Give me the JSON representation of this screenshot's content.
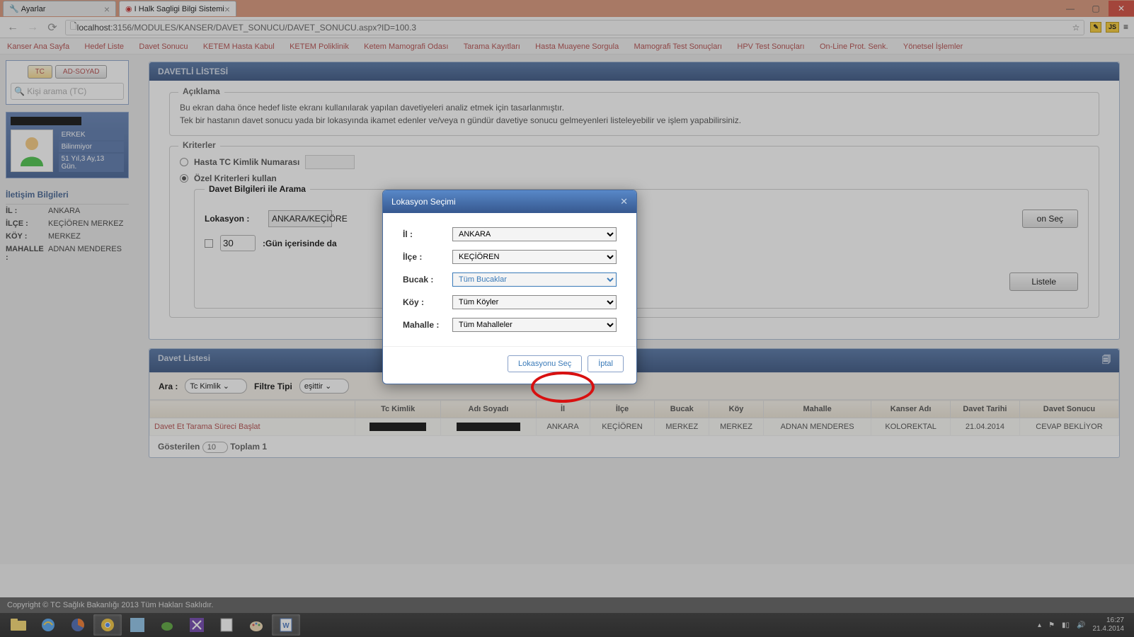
{
  "browser": {
    "tab1": "Ayarlar",
    "tab2": "I Halk Sagligi Bilgi Sistemi",
    "url_host": "localhost",
    "url_path": ":3156/MODULES/KANSER/DAVET_SONUCU/DAVET_SONUCU.aspx?ID=100.3"
  },
  "topmenu": {
    "items": [
      "Kanser Ana Sayfa",
      "Hedef Liste",
      "Davet Sonucu",
      "KETEM Hasta Kabul",
      "KETEM Poliklinik",
      "Ketem Mamografi Odası",
      "Tarama Kayıtları",
      "Hasta Muayene Sorgula",
      "Mamografi Test Sonuçları",
      "HPV Test Sonuçları",
      "On-Line Prot. Senk.",
      "Yönetsel İşlemler"
    ]
  },
  "sidebar": {
    "tab_tc": "TC",
    "tab_ad": "AD-SOYAD",
    "search_placeholder": "Kişi arama (TC)",
    "profile": {
      "gender": "ERKEK",
      "status": "Bilinmiyor",
      "age": "51 Yıl,3 Ay,13 Gün."
    },
    "contact_header": "İletişim Bilgileri",
    "contact": {
      "il_lbl": "İL :",
      "il": "ANKARA",
      "ilce_lbl": "İLÇE :",
      "ilce": "KEÇİÖREN MERKEZ",
      "koy_lbl": "KÖY :",
      "koy": "MERKEZ",
      "mah_lbl": "MAHALLE :",
      "mah": "ADNAN MENDERES"
    }
  },
  "panel": {
    "title": "DAVETLİ LİSTESİ",
    "aciklama_legend": "Açıklama",
    "aciklama_l1": "Bu ekran daha önce hedef liste ekranı kullanılarak yapılan davetiyeleri analiz etmek için tasarlanmıştır.",
    "aciklama_l2": "Tek bir hastanın davet sonucu yada bir lokasyında ikamet edenler ve/veya n gündür davetiye sonucu gelmeyenleri listeleyebilir ve işlem yapabilirsiniz.",
    "kriter_legend": "Kriterler",
    "radio1": "Hasta TC Kimlik Numarası",
    "radio2": "Özel Kriterleri kullan",
    "davet_legend": "Davet Bilgileri ile Arama",
    "lokasyon_lbl": "Lokasyon :",
    "lokasyon_val": "ANKARA/KEÇİÖRE",
    "lokasyon_btn": "on Seç",
    "gun_val": "30",
    "gun_text": ":Gün içerisinde da",
    "listele_btn": "Listele"
  },
  "davet_panel": {
    "title": "Davet Listesi",
    "ara_lbl": "Ara :",
    "ara_sel": "Tc Kimlik",
    "filtre_lbl": "Filtre Tipi",
    "filtre_sel": "eşittir",
    "headers": [
      "",
      "Tc Kimlik",
      "Adı Soyadı",
      "İl",
      "İlçe",
      "Bucak",
      "Köy",
      "Mahalle",
      "Kanser Adı",
      "Davet Tarihi",
      "Davet Sonucu"
    ],
    "row": {
      "action": "Davet Et Tarama Süreci Başlat",
      "il": "ANKARA",
      "ilce": "KEÇİÖREN",
      "bucak": "MERKEZ",
      "koy": "MERKEZ",
      "mahalle": "ADNAN MENDERES",
      "kanser": "KOLOREKTAL",
      "tarih": "21.04.2014",
      "sonuc": "CEVAP BEKLİYOR"
    },
    "gosterilen_lbl": "Gösterilen",
    "gosterilen_val": "10",
    "toplam": "Toplam 1"
  },
  "dialog": {
    "title": "Lokasyon Seçimi",
    "il_lbl": "İl :",
    "il": "ANKARA",
    "ilce_lbl": "İlçe :",
    "ilce": "KEÇİÖREN",
    "bucak_lbl": "Bucak :",
    "bucak": "Tüm Bucaklar",
    "koy_lbl": "Köy :",
    "koy": "Tüm Köyler",
    "mahalle_lbl": "Mahalle :",
    "mahalle": "Tüm Mahalleler",
    "ok_btn": "Lokasyonu Seç",
    "cancel_btn": "İptal"
  },
  "footer": "Copyright © TC Sağlık Bakanlığı 2013  Tüm Hakları Saklıdır.",
  "tray": {
    "time": "16:27",
    "date": "21.4.2014"
  }
}
